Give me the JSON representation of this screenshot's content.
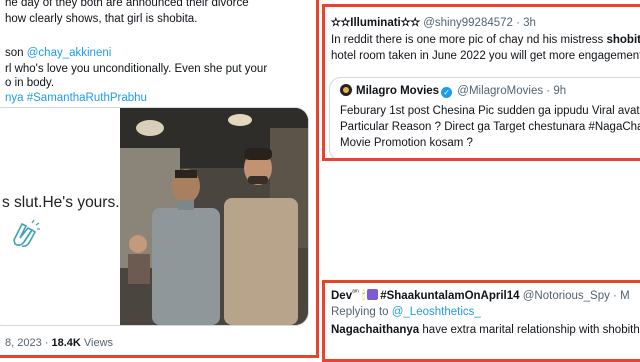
{
  "colors": {
    "highlight_border": "#e8432c",
    "link": "#1d9bf0",
    "muted": "#536471"
  },
  "left_tweet": {
    "lines": [
      "he day of they both are announced their divorce",
      "how clearly shows, that girl is shobita."
    ],
    "line3_prefix": "son ",
    "mention": "@chay_akkineni",
    "line4": "rl who's love you unconditionally. Even she put your",
    "line5": "o in body.",
    "hashtags": "nya #SamanthaRuthPrabhu",
    "media_text": "s slut.He's yours.",
    "media_icon": "clapping-hands-icon",
    "meta_date": "8, 2023 · ",
    "views_count": "18.4K",
    "views_label": " Views"
  },
  "top_right_tweet": {
    "name": "✫✫Illuminati✫✫",
    "handle": "@shiny99284572",
    "time": "· 3h",
    "line1_prefix": "In reddit there is one more pic of chay nd his mistress ",
    "line1_bold": "shobit",
    "line2": "hotel room taken in June 2022 you will get more engagement",
    "quote": {
      "name": "Milagro Movies",
      "handle": "@MilagroMovies",
      "time": "· 9h",
      "line1": "Feburary 1st post Chesina Pic sudden ga ippudu Viral avata",
      "line2": "Particular Reason ? Direct ga Target chestunara  #NagaCha",
      "line3": "Movie Promotion kosam ?"
    }
  },
  "bottom_right_tweet": {
    "name_prefix": "Dev",
    "name_suffix": "#ShaakuntalamOnApril14",
    "handle": "@Notorious_Spy · M",
    "replying_label": "Replying to ",
    "replying_handle": "@_Leoshthetics_",
    "body_bold": "Nagachaithanya",
    "body_rest": " have extra marital relationship with shobith"
  }
}
